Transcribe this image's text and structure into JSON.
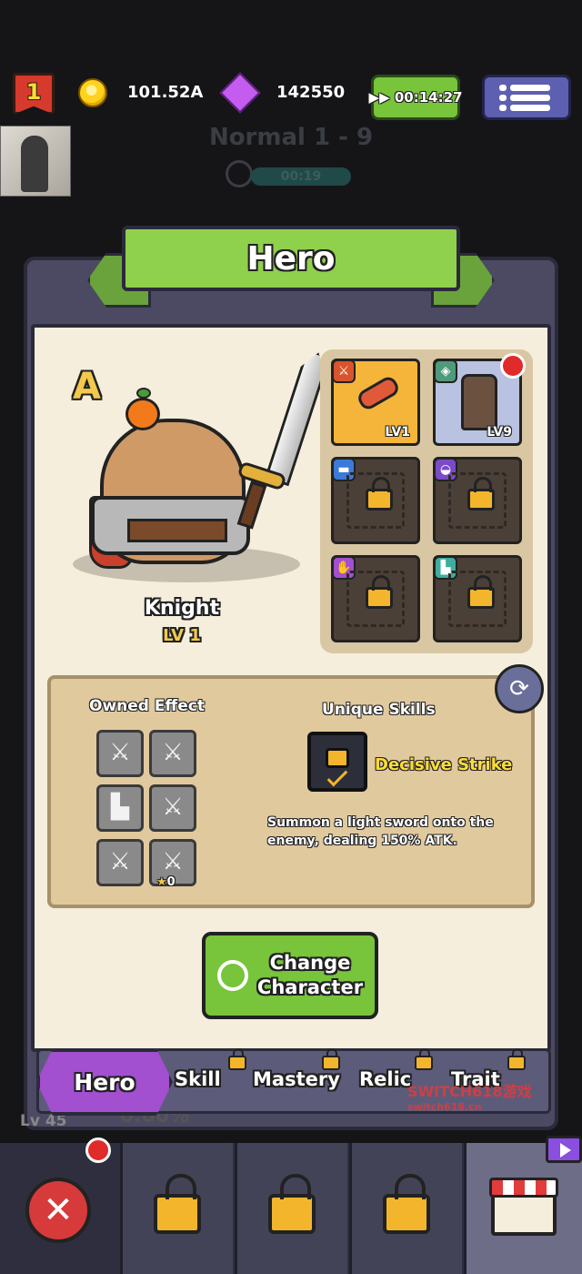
{
  "top_bar": {
    "level": "1",
    "gold": "101.52A",
    "gems": "142550",
    "timer": "00:14:27",
    "menu_icon": "menu-list-icon"
  },
  "stage": {
    "name": "Normal 1 - 9",
    "countdown": "00:19"
  },
  "panel": {
    "title": "Hero"
  },
  "hero": {
    "grade": "A",
    "name": "Knight",
    "level": "LV 1"
  },
  "equipment": [
    {
      "slot": "weapon",
      "tag_icon": "sword-icon",
      "level": "LV1",
      "locked": false,
      "color": "#f4b53a"
    },
    {
      "slot": "armor",
      "tag_icon": "shield-icon",
      "level": "LV9",
      "locked": false,
      "color": "#b9c2e0",
      "notification": true
    },
    {
      "slot": "belt",
      "tag_icon": "belt-icon",
      "locked": true
    },
    {
      "slot": "helmet",
      "tag_icon": "helmet-icon",
      "locked": true
    },
    {
      "slot": "gloves",
      "tag_icon": "glove-icon",
      "locked": true
    },
    {
      "slot": "boots",
      "tag_icon": "boot-icon",
      "locked": true
    }
  ],
  "owned_effect": {
    "title": "Owned Effect",
    "items": [
      "sword-icon",
      "sword-icon",
      "boot-icon",
      "sword-icon",
      "sword-icon",
      "sword-icon"
    ],
    "star_count": "0"
  },
  "unique_skills": {
    "title": "Unique Skills",
    "name": "Decisive Strike",
    "description": "Summon a light sword onto the enemy, dealing 150% ATK."
  },
  "change_button": {
    "line1": "Change",
    "line2": "Character"
  },
  "tabs": [
    {
      "label": "Hero",
      "active": true,
      "locked": false
    },
    {
      "label": "Skill",
      "active": false,
      "locked": true
    },
    {
      "label": "Mastery",
      "active": false,
      "locked": true
    },
    {
      "label": "Relic",
      "active": false,
      "locked": true
    },
    {
      "label": "Trait",
      "active": false,
      "locked": true
    }
  ],
  "background": {
    "lv": "Lv 45",
    "pct": "0.00%"
  },
  "watermark": {
    "line1": "SWITCH618游戏",
    "line2": "switch618.cn"
  },
  "bottom_nav": {
    "close_icon": "close-icon",
    "shop_icon": "shop-icon"
  },
  "colors": {
    "accent_green": "#78c43a",
    "accent_purple": "#a24fd0",
    "gold_text": "#f2c94c",
    "skill_text": "#ffdc35"
  }
}
